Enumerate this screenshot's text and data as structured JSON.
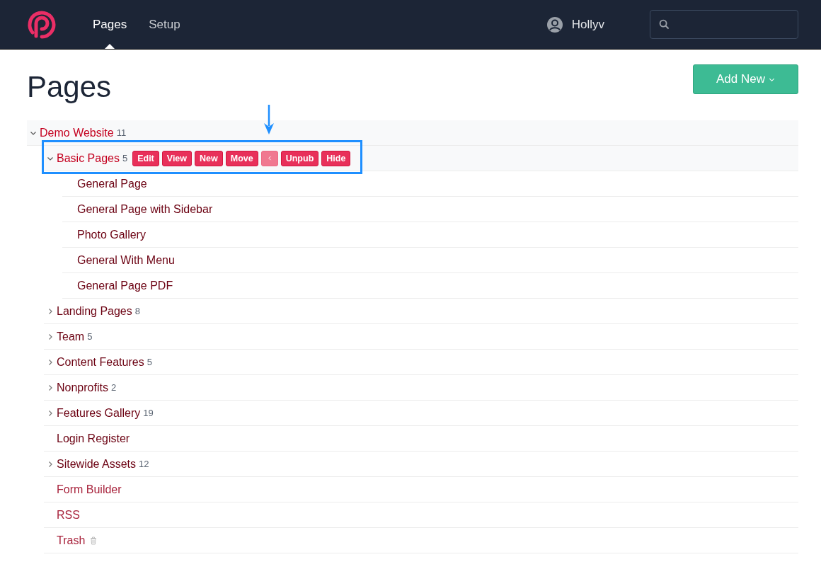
{
  "nav": {
    "items": [
      {
        "label": "Pages",
        "selected": true
      },
      {
        "label": "Setup",
        "selected": false
      }
    ],
    "user": "Hollyv"
  },
  "title": "Pages",
  "add_button": "Add New",
  "tree": [
    {
      "label": "Demo Website",
      "count": "11",
      "kind": "page",
      "expanded": true,
      "children": [
        {
          "label": "Basic Pages",
          "count": "5",
          "kind": "page",
          "expanded": true,
          "actions": [
            {
              "kind": "text",
              "label": "Edit"
            },
            {
              "kind": "text",
              "label": "View"
            },
            {
              "kind": "text",
              "label": "New"
            },
            {
              "kind": "text",
              "label": "Move"
            },
            {
              "kind": "collapse"
            },
            {
              "kind": "text",
              "label": "Unpub"
            },
            {
              "kind": "text",
              "label": "Hide"
            }
          ],
          "children": [
            {
              "label": "General Page",
              "kind": "page"
            },
            {
              "label": "General Page with Sidebar",
              "kind": "page"
            },
            {
              "label": "Photo Gallery",
              "kind": "page"
            },
            {
              "label": "General With Menu",
              "kind": "page"
            },
            {
              "label": "General Page PDF",
              "kind": "page"
            }
          ]
        },
        {
          "label": "Landing Pages",
          "count": "8",
          "kind": "page",
          "expanded": false
        },
        {
          "label": "Team",
          "count": "5",
          "kind": "page",
          "expanded": false
        },
        {
          "label": "Content Features",
          "count": "5",
          "kind": "page",
          "expanded": false
        },
        {
          "label": "Nonprofits",
          "count": "2",
          "kind": "page",
          "expanded": false
        },
        {
          "label": "Features Gallery",
          "count": "19",
          "kind": "page",
          "expanded": false
        },
        {
          "label": "Login Register",
          "kind": "page"
        },
        {
          "label": "Sitewide Assets",
          "count": "12",
          "kind": "page",
          "expanded": false
        },
        {
          "label": "Form Builder",
          "kind": "system"
        },
        {
          "label": "RSS",
          "kind": "system"
        },
        {
          "label": "Trash",
          "kind": "trash"
        }
      ]
    }
  ]
}
